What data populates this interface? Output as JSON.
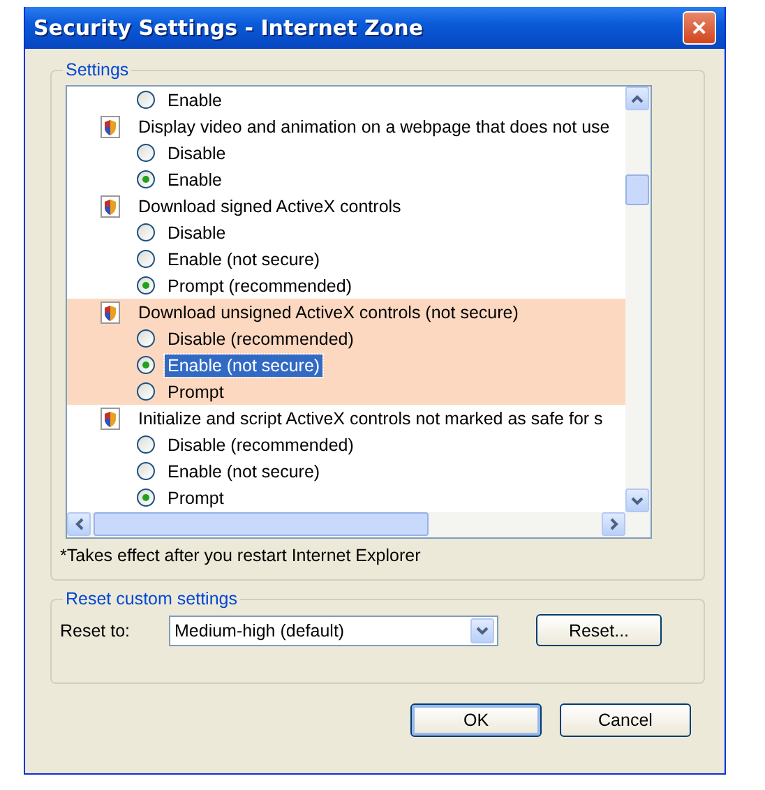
{
  "window": {
    "title": "Security Settings - Internet Zone",
    "close": "✕"
  },
  "settings": {
    "legend": "Settings",
    "groups": [
      {
        "highlighted": false,
        "options": [
          {
            "label": "Enable",
            "selected": false,
            "focused": false
          }
        ]
      },
      {
        "title": "Display video and animation on a webpage that does not use",
        "highlighted": false,
        "options": [
          {
            "label": "Disable",
            "selected": false,
            "focused": false
          },
          {
            "label": "Enable",
            "selected": true,
            "focused": false
          }
        ]
      },
      {
        "title": "Download signed ActiveX controls",
        "highlighted": false,
        "options": [
          {
            "label": "Disable",
            "selected": false,
            "focused": false
          },
          {
            "label": "Enable (not secure)",
            "selected": false,
            "focused": false
          },
          {
            "label": "Prompt (recommended)",
            "selected": true,
            "focused": false
          }
        ]
      },
      {
        "title": "Download unsigned ActiveX controls (not secure)",
        "highlighted": true,
        "options": [
          {
            "label": "Disable (recommended)",
            "selected": false,
            "focused": false
          },
          {
            "label": "Enable (not secure)",
            "selected": true,
            "focused": true
          },
          {
            "label": "Prompt",
            "selected": false,
            "focused": false
          }
        ]
      },
      {
        "title": "Initialize and script ActiveX controls not marked as safe for s",
        "highlighted": false,
        "options": [
          {
            "label": "Disable (recommended)",
            "selected": false,
            "focused": false
          },
          {
            "label": "Enable (not secure)",
            "selected": false,
            "focused": false
          },
          {
            "label": "Prompt",
            "selected": true,
            "focused": false
          }
        ]
      }
    ],
    "note": "*Takes effect after you restart Internet Explorer"
  },
  "reset": {
    "legend": "Reset custom settings",
    "label": "Reset to:",
    "value": "Medium-high (default)",
    "button": "Reset..."
  },
  "buttons": [
    "OK",
    "Cancel"
  ]
}
